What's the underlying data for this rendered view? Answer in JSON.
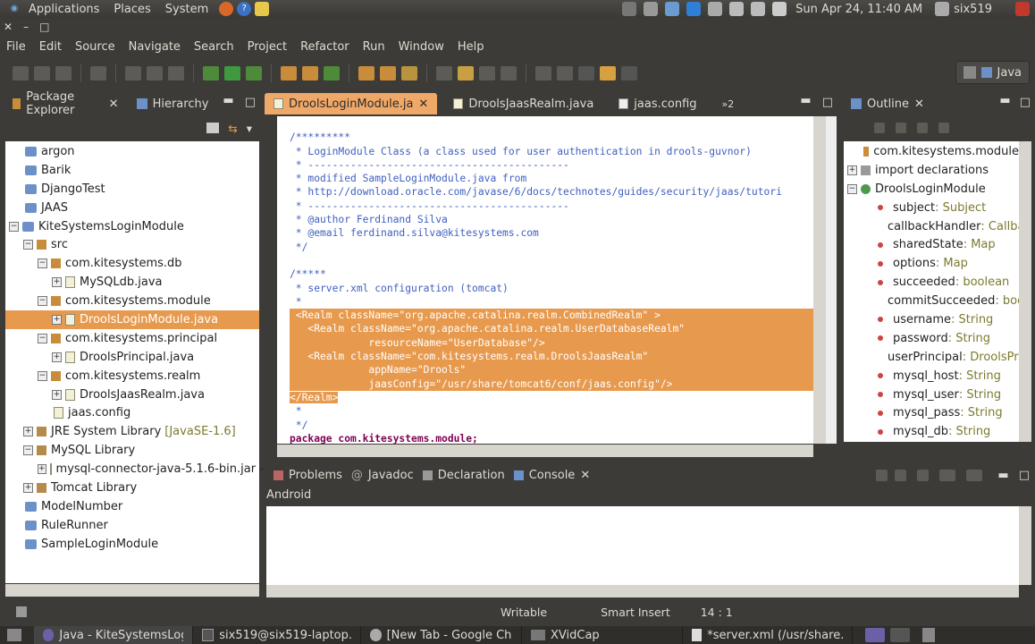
{
  "top_panel": {
    "menus": [
      "Applications",
      "Places",
      "System"
    ],
    "clock": "Sun Apr 24, 11:40 AM",
    "user": "six519"
  },
  "menubar": [
    "File",
    "Edit",
    "Source",
    "Navigate",
    "Search",
    "Project",
    "Refactor",
    "Run",
    "Window",
    "Help"
  ],
  "perspective": {
    "label": "Java"
  },
  "package_explorer": {
    "tabs": [
      "Package Explorer",
      "Hierarchy"
    ],
    "rows": [
      {
        "label": "argon",
        "suffix": ""
      },
      {
        "label": "Barik",
        "suffix": ""
      },
      {
        "label": "DjangoTest",
        "suffix": ""
      },
      {
        "label": "JAAS",
        "suffix": ""
      },
      {
        "label": "KiteSystemsLoginModule",
        "suffix": ""
      },
      {
        "label": "src",
        "suffix": ""
      },
      {
        "label": "com.kitesystems.db",
        "suffix": ""
      },
      {
        "label": "MySQLdb.java",
        "suffix": ""
      },
      {
        "label": "com.kitesystems.module",
        "suffix": ""
      },
      {
        "label": "DroolsLoginModule.java",
        "suffix": ""
      },
      {
        "label": "com.kitesystems.principal",
        "suffix": ""
      },
      {
        "label": "DroolsPrincipal.java",
        "suffix": ""
      },
      {
        "label": "com.kitesystems.realm",
        "suffix": ""
      },
      {
        "label": "DroolsJaasRealm.java",
        "suffix": ""
      },
      {
        "label": "jaas.config",
        "suffix": ""
      },
      {
        "label": "JRE System Library",
        "suffix": "[JavaSE-1.6]"
      },
      {
        "label": "MySQL Library",
        "suffix": ""
      },
      {
        "label": "mysql-connector-java-5.1.6-bin.jar -",
        "suffix": ""
      },
      {
        "label": "Tomcat Library",
        "suffix": ""
      },
      {
        "label": "ModelNumber",
        "suffix": ""
      },
      {
        "label": "RuleRunner",
        "suffix": ""
      },
      {
        "label": "SampleLoginModule",
        "suffix": ""
      }
    ]
  },
  "editor": {
    "tabs": [
      "DroolsLoginModule.ja",
      "DroolsJaasRealm.java",
      "jaas.config",
      "»2"
    ],
    "lines": [
      "/*********",
      " * LoginModule Class (a class used for user authentication in drools-guvnor)",
      " * -------------------------------------------",
      " * modified SampleLoginModule.java from",
      " * http://download.oracle.com/javase/6/docs/technotes/guides/security/jaas/tutori",
      " * -------------------------------------------",
      " * @author Ferdinand Silva",
      " * @email ferdinand.silva@kitesystems.com",
      " */",
      "",
      "/*****",
      " * server.xml configuration (tomcat)",
      " *",
      " <Realm className=\"org.apache.catalina.realm.CombinedRealm\" >",
      "   <Realm className=\"org.apache.catalina.realm.UserDatabaseRealm\"",
      "             resourceName=\"UserDatabase\"/>",
      "   <Realm className=\"com.kitesystems.realm.DroolsJaasRealm\"",
      "             appName=\"Drools\"",
      "             jaasConfig=\"/usr/share/tomcat6/conf/jaas.config\"/>",
      "</Realm>",
      " *",
      " */",
      "package com.kitesystems.module;"
    ]
  },
  "outline": {
    "tab": "Outline",
    "rows": [
      {
        "label": "com.kitesystems.module",
        "type": ""
      },
      {
        "label": "import declarations",
        "type": ""
      },
      {
        "label": "DroolsLoginModule",
        "type": ""
      },
      {
        "label": "subject",
        "type": " : Subject"
      },
      {
        "label": "callbackHandler",
        "type": " : Callba"
      },
      {
        "label": "sharedState",
        "type": " : Map"
      },
      {
        "label": "options",
        "type": " : Map"
      },
      {
        "label": "succeeded",
        "type": " : boolean"
      },
      {
        "label": "commitSucceeded",
        "type": " : boo"
      },
      {
        "label": "username",
        "type": " : String"
      },
      {
        "label": "password",
        "type": " : String"
      },
      {
        "label": "userPrincipal",
        "type": " : DroolsPri"
      },
      {
        "label": "mysql_host",
        "type": " : String"
      },
      {
        "label": "mysql_user",
        "type": " : String"
      },
      {
        "label": "mysql_pass",
        "type": " : String"
      },
      {
        "label": "mysql_db",
        "type": " : String"
      }
    ]
  },
  "bottom": {
    "tabs": [
      "Problems",
      "Javadoc",
      "Declaration",
      "Console"
    ],
    "console_label": "Android"
  },
  "status": {
    "writable": "Writable",
    "insert": "Smart Insert",
    "position": "14 : 1"
  },
  "taskbar": [
    "Java - KiteSystemsLog...",
    "six519@six519-laptop...",
    "[New Tab - Google Chr...",
    "XVidCap",
    "*server.xml (/usr/share..."
  ]
}
